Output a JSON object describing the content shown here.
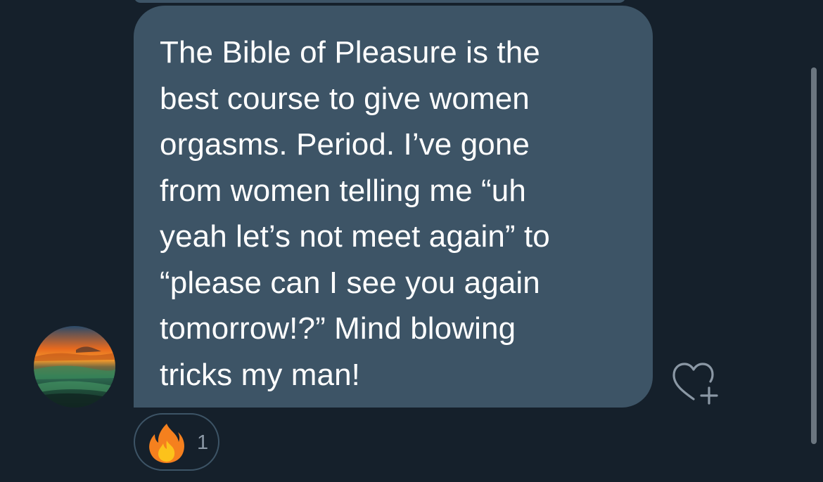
{
  "message": {
    "text": "The Bible of Pleasure is the\nbest course to give women\norgasms. Period. I’ve gone\nfrom women telling me “uh\nyeah let’s not meet again” to\n“please can I see you again\ntomorrow!?” Mind blowing\ntricks my man!",
    "bubble_color": "#3d5466",
    "text_color": "#ffffff"
  },
  "reactions": [
    {
      "emoji_icon": "fire-emoji-icon",
      "count": "1"
    }
  ],
  "add_reaction_icon": "heart-plus-icon",
  "colors": {
    "background": "#15202b",
    "muted_text": "#8b98a5"
  }
}
